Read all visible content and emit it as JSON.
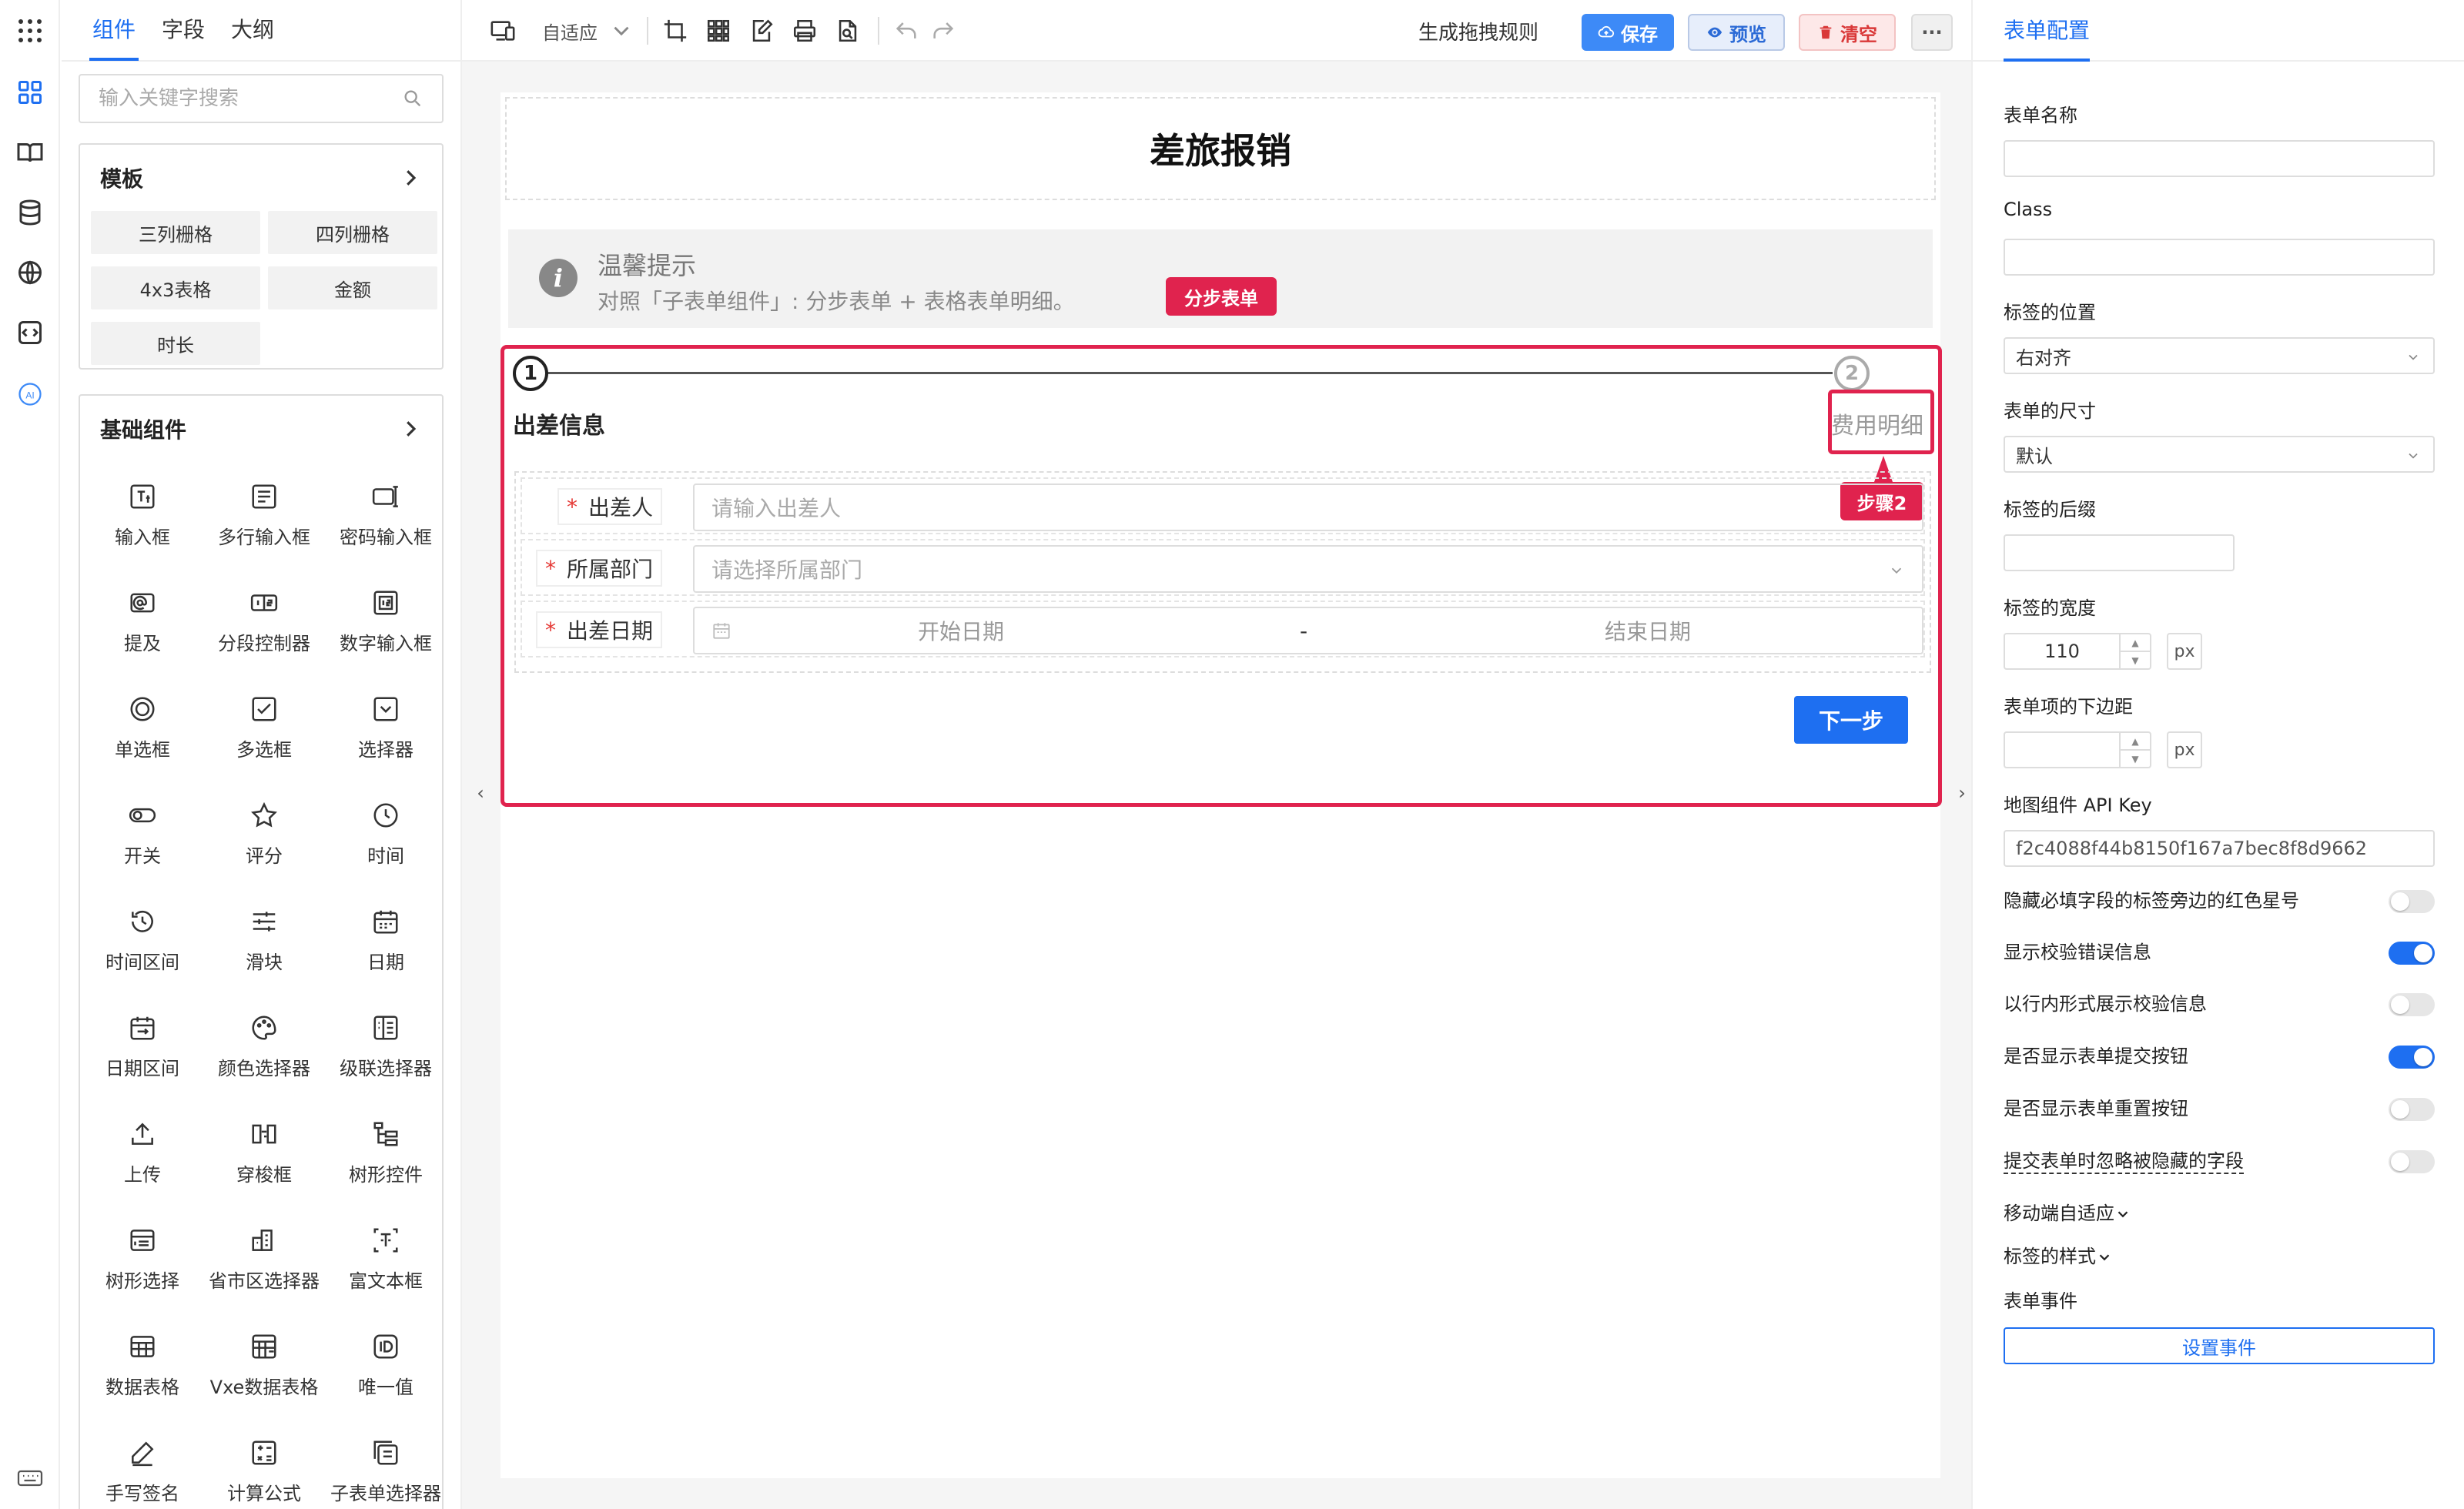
{
  "left": {
    "tabs": [
      "组件",
      "字段",
      "大纲"
    ],
    "search_placeholder": "输入关键字搜索",
    "templates": {
      "title": "模板",
      "items": [
        "三列栅格",
        "四列栅格",
        "4x3表格",
        "金额",
        "时长"
      ]
    },
    "basic": {
      "title": "基础组件",
      "items": [
        {
          "label": "输入框",
          "icon": "text-input-icon"
        },
        {
          "label": "多行输入框",
          "icon": "textarea-icon"
        },
        {
          "label": "密码输入框",
          "icon": "password-icon"
        },
        {
          "label": "提及",
          "icon": "mention-icon"
        },
        {
          "label": "分段控制器",
          "icon": "segmented-icon"
        },
        {
          "label": "数字输入框",
          "icon": "number-input-icon"
        },
        {
          "label": "单选框",
          "icon": "radio-icon"
        },
        {
          "label": "多选框",
          "icon": "checkbox-icon"
        },
        {
          "label": "选择器",
          "icon": "select-icon"
        },
        {
          "label": "开关",
          "icon": "switch-icon"
        },
        {
          "label": "评分",
          "icon": "star-icon"
        },
        {
          "label": "时间",
          "icon": "clock-icon"
        },
        {
          "label": "时间区间",
          "icon": "time-range-icon"
        },
        {
          "label": "滑块",
          "icon": "slider-icon"
        },
        {
          "label": "日期",
          "icon": "calendar-icon"
        },
        {
          "label": "日期区间",
          "icon": "date-range-icon"
        },
        {
          "label": "颜色选择器",
          "icon": "palette-icon"
        },
        {
          "label": "级联选择器",
          "icon": "cascader-icon"
        },
        {
          "label": "上传",
          "icon": "upload-icon"
        },
        {
          "label": "穿梭框",
          "icon": "transfer-icon"
        },
        {
          "label": "树形控件",
          "icon": "tree-icon"
        },
        {
          "label": "树形选择",
          "icon": "tree-select-icon"
        },
        {
          "label": "省市区选择器",
          "icon": "region-icon"
        },
        {
          "label": "富文本框",
          "icon": "rich-text-icon"
        },
        {
          "label": "数据表格",
          "icon": "table-icon"
        },
        {
          "label": "Vxe数据表格",
          "icon": "vxe-table-icon"
        },
        {
          "label": "唯一值",
          "icon": "id-icon"
        },
        {
          "label": "手写签名",
          "icon": "signature-icon"
        },
        {
          "label": "计算公式",
          "icon": "calculator-icon"
        },
        {
          "label": "子表单选择器",
          "icon": "subform-icon"
        }
      ]
    }
  },
  "toolbar": {
    "layout_select": "自适应",
    "generate_rules": "生成拖拽规则",
    "save": "保存",
    "preview": "预览",
    "clear": "清空",
    "more": "···"
  },
  "canvas": {
    "form_title": "差旅报销",
    "tip_title": "温馨提示",
    "tip_desc": "对照「子表单组件」: 分步表单 + 表格表单明细。",
    "callout_step_form": "分步表单",
    "callout_step2": "步骤2",
    "steps": [
      {
        "num": "1",
        "label": "出差信息"
      },
      {
        "num": "2",
        "label": "费用明细"
      }
    ],
    "fields": [
      {
        "label": "出差人",
        "placeholder": "请输入出差人"
      },
      {
        "label": "所属部门",
        "placeholder": "请选择所属部门"
      },
      {
        "label": "出差日期",
        "start": "开始日期",
        "sep": "-",
        "end": "结束日期"
      }
    ],
    "next_button": "下一步"
  },
  "right": {
    "tab": "表单配置",
    "form_name_label": "表单名称",
    "form_name_value": "",
    "class_label": "Class",
    "class_value": "",
    "label_position_label": "标签的位置",
    "label_position_value": "右对齐",
    "form_size_label": "表单的尺寸",
    "form_size_value": "默认",
    "label_suffix_label": "标签的后缀",
    "label_suffix_value": "",
    "label_width_label": "标签的宽度",
    "label_width_value": "110",
    "label_width_unit": "px",
    "item_margin_label": "表单项的下边距",
    "item_margin_value": "",
    "item_margin_unit": "px",
    "map_key_label": "地图组件 API Key",
    "map_key_value": "f2c4088f44b8150f167a7bec8f8d9662",
    "toggles": [
      {
        "label": "隐藏必填字段的标签旁边的红色星号",
        "on": false
      },
      {
        "label": "显示校验错误信息",
        "on": true
      },
      {
        "label": "以行内形式展示校验信息",
        "on": false
      },
      {
        "label": "是否显示表单提交按钮",
        "on": true
      },
      {
        "label": "是否显示表单重置按钮",
        "on": false
      },
      {
        "label": "提交表单时忽略被隐藏的字段",
        "on": false
      }
    ],
    "mobile_adapt": "移动端自适应",
    "label_style": "标签的样式",
    "form_events": "表单事件",
    "set_events": "设置事件"
  },
  "colors": {
    "primary": "#1e6ff1",
    "highlight": "#e0234e"
  }
}
